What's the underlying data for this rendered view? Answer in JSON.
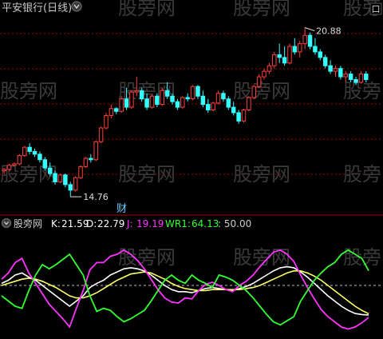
{
  "top_panel": {
    "title": "平安银行(日线)",
    "corner_button": "口",
    "high_label": "20.88",
    "low_label": "14.76",
    "marker_label": "财",
    "watermark": "股旁网",
    "colors": {
      "up": "#ff4040",
      "down": "#33ffff",
      "grid": "#a00000",
      "text": "#c8c8c8"
    }
  },
  "indicator_panel": {
    "name": "股旁网",
    "k_label": "K:",
    "k_value": "21.59",
    "d_label": "D:",
    "d_value": "22.79",
    "j_label": "J:",
    "j_value": "19.19",
    "wr1_label": "WR1:",
    "wr1_value": "64.13",
    "level_label": ": 50.00",
    "colors": {
      "k": "#ffffff",
      "d": "#ffff66",
      "j": "#ff33ff",
      "wr1": "#33ff33"
    }
  },
  "chart_data": [
    {
      "type": "candlestick",
      "title": "平安银行(日线)",
      "price_range": [
        14.3,
        21.3
      ],
      "annotations": [
        {
          "label": "20.88",
          "kind": "high"
        },
        {
          "label": "14.76",
          "kind": "low"
        }
      ],
      "candles": [
        [
          15.7,
          15.8,
          15.6,
          15.75
        ],
        [
          15.75,
          15.95,
          15.7,
          15.9
        ],
        [
          15.9,
          16.0,
          15.85,
          15.95
        ],
        [
          15.95,
          16.3,
          15.9,
          16.25
        ],
        [
          16.25,
          16.6,
          16.2,
          16.55
        ],
        [
          16.55,
          16.7,
          16.3,
          16.4
        ],
        [
          16.4,
          16.5,
          16.2,
          16.3
        ],
        [
          16.3,
          16.4,
          16.0,
          16.1
        ],
        [
          16.1,
          16.2,
          15.7,
          15.8
        ],
        [
          15.8,
          16.0,
          15.5,
          15.6
        ],
        [
          15.6,
          15.7,
          15.2,
          15.3
        ],
        [
          15.3,
          15.6,
          15.25,
          15.55
        ],
        [
          15.55,
          15.6,
          15.1,
          15.2
        ],
        [
          15.2,
          15.3,
          14.76,
          15.0
        ],
        [
          15.0,
          15.5,
          14.95,
          15.45
        ],
        [
          15.45,
          15.9,
          15.4,
          15.85
        ],
        [
          15.85,
          16.2,
          15.8,
          16.15
        ],
        [
          16.15,
          16.3,
          16.0,
          16.1
        ],
        [
          16.1,
          16.8,
          16.05,
          16.75
        ],
        [
          16.75,
          17.3,
          16.7,
          17.25
        ],
        [
          17.25,
          17.8,
          17.2,
          17.7
        ],
        [
          17.7,
          18.1,
          17.6,
          17.95
        ],
        [
          17.95,
          18.0,
          17.75,
          17.85
        ],
        [
          17.85,
          18.4,
          17.8,
          18.3
        ],
        [
          18.3,
          18.7,
          17.9,
          18.0
        ],
        [
          18.0,
          18.6,
          17.95,
          18.55
        ],
        [
          18.55,
          19.1,
          18.4,
          18.6
        ],
        [
          18.6,
          18.7,
          18.2,
          18.3
        ],
        [
          18.3,
          18.5,
          17.9,
          18.0
        ],
        [
          18.0,
          18.45,
          17.95,
          18.4
        ],
        [
          18.4,
          18.5,
          18.0,
          18.1
        ],
        [
          18.1,
          18.7,
          18.05,
          18.6
        ],
        [
          18.6,
          18.9,
          18.3,
          18.4
        ],
        [
          18.4,
          18.5,
          18.1,
          18.2
        ],
        [
          18.2,
          18.3,
          17.9,
          18.0
        ],
        [
          18.0,
          18.4,
          17.95,
          18.35
        ],
        [
          18.35,
          18.5,
          18.2,
          18.3
        ],
        [
          18.3,
          18.8,
          18.25,
          18.75
        ],
        [
          18.75,
          18.8,
          18.3,
          18.4
        ],
        [
          18.4,
          18.6,
          18.0,
          18.1
        ],
        [
          18.1,
          18.3,
          17.8,
          17.9
        ],
        [
          17.9,
          18.2,
          17.85,
          18.15
        ],
        [
          18.15,
          18.6,
          18.1,
          18.5
        ],
        [
          18.5,
          18.6,
          18.2,
          18.3
        ],
        [
          18.3,
          18.4,
          17.9,
          18.0
        ],
        [
          18.0,
          18.2,
          17.7,
          17.8
        ],
        [
          17.8,
          17.9,
          17.4,
          17.5
        ],
        [
          17.5,
          17.95,
          17.45,
          17.9
        ],
        [
          17.9,
          18.4,
          17.85,
          18.35
        ],
        [
          18.35,
          18.8,
          18.3,
          18.75
        ],
        [
          18.75,
          19.2,
          18.7,
          19.1
        ],
        [
          19.1,
          19.4,
          19.0,
          19.3
        ],
        [
          19.3,
          19.6,
          19.2,
          19.5
        ],
        [
          19.5,
          20.0,
          19.4,
          19.9
        ],
        [
          19.9,
          20.3,
          19.6,
          19.8
        ],
        [
          19.8,
          20.2,
          19.5,
          19.6
        ],
        [
          19.6,
          20.3,
          19.55,
          20.2
        ],
        [
          20.2,
          20.5,
          19.9,
          20.0
        ],
        [
          20.0,
          20.4,
          19.8,
          20.3
        ],
        [
          20.3,
          20.88,
          20.1,
          20.6
        ],
        [
          20.6,
          20.7,
          20.1,
          20.2
        ],
        [
          20.2,
          20.5,
          19.9,
          20.0
        ],
        [
          20.0,
          20.1,
          19.7,
          19.8
        ],
        [
          19.8,
          19.9,
          19.4,
          19.5
        ],
        [
          19.5,
          19.7,
          19.2,
          19.3
        ],
        [
          19.3,
          19.5,
          19.1,
          19.4
        ],
        [
          19.4,
          19.5,
          19.0,
          19.1
        ],
        [
          19.1,
          19.3,
          18.9,
          19.2
        ],
        [
          19.2,
          19.3,
          18.9,
          19.0
        ],
        [
          19.0,
          19.1,
          18.8,
          18.9
        ],
        [
          18.9,
          19.3,
          18.85,
          19.2
        ],
        [
          19.2,
          19.3,
          18.9,
          19.0
        ]
      ]
    },
    {
      "type": "line",
      "title": "股旁网",
      "ylim": [
        0,
        100
      ],
      "reference_line": 50,
      "series": [
        {
          "name": "K",
          "values": [
            52,
            55,
            60,
            62,
            58,
            55,
            50,
            45,
            40,
            35,
            30,
            35,
            40,
            48,
            52,
            55,
            60,
            63,
            66,
            67,
            66,
            64,
            60,
            55,
            50,
            46,
            44,
            44,
            43,
            45,
            47,
            48,
            47,
            46,
            45,
            47,
            49,
            52,
            56,
            60,
            64,
            67,
            68,
            67,
            63,
            58,
            52,
            46,
            40,
            35,
            30,
            26,
            23,
            22,
            21.59
          ]
        },
        {
          "name": "D",
          "values": [
            50,
            52,
            54,
            56,
            57,
            56,
            54,
            51,
            48,
            44,
            40,
            38,
            38,
            40,
            43,
            47,
            51,
            55,
            58,
            61,
            62,
            63,
            62,
            59,
            56,
            52,
            49,
            47,
            46,
            45,
            45,
            46,
            46,
            46,
            46,
            46,
            47,
            48,
            50,
            53,
            56,
            59,
            62,
            64,
            64,
            62,
            59,
            55,
            50,
            45,
            40,
            35,
            30,
            26,
            22.79
          ]
        },
        {
          "name": "J",
          "values": [
            56,
            62,
            72,
            76,
            62,
            52,
            42,
            32,
            25,
            18,
            10,
            28,
            45,
            65,
            72,
            72,
            78,
            80,
            84,
            80,
            74,
            66,
            56,
            46,
            38,
            34,
            33,
            38,
            37,
            45,
            51,
            53,
            50,
            46,
            44,
            50,
            54,
            60,
            68,
            75,
            82,
            84,
            80,
            73,
            60,
            48,
            37,
            27,
            20,
            15,
            10,
            8,
            10,
            14,
            19.19
          ]
        },
        {
          "name": "WR1",
          "values": [
            40,
            35,
            30,
            28,
            45,
            60,
            70,
            66,
            70,
            75,
            80,
            70,
            60,
            40,
            25,
            28,
            26,
            20,
            15,
            18,
            22,
            26,
            35,
            45,
            55,
            60,
            55,
            52,
            60,
            55,
            52,
            48,
            60,
            58,
            55,
            50,
            45,
            38,
            30,
            22,
            15,
            12,
            16,
            20,
            35,
            45,
            55,
            62,
            68,
            72,
            80,
            84,
            80,
            76,
            64.13
          ]
        }
      ]
    }
  ]
}
